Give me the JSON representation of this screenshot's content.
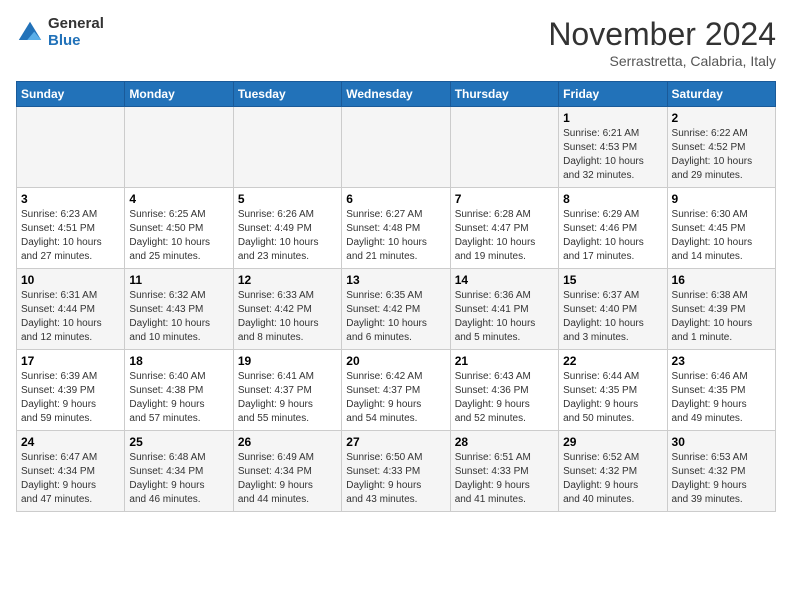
{
  "logo": {
    "general": "General",
    "blue": "Blue"
  },
  "title": "November 2024",
  "location": "Serrastretta, Calabria, Italy",
  "weekdays": [
    "Sunday",
    "Monday",
    "Tuesday",
    "Wednesday",
    "Thursday",
    "Friday",
    "Saturday"
  ],
  "weeks": [
    [
      {
        "day": "",
        "info": ""
      },
      {
        "day": "",
        "info": ""
      },
      {
        "day": "",
        "info": ""
      },
      {
        "day": "",
        "info": ""
      },
      {
        "day": "",
        "info": ""
      },
      {
        "day": "1",
        "info": "Sunrise: 6:21 AM\nSunset: 4:53 PM\nDaylight: 10 hours\nand 32 minutes."
      },
      {
        "day": "2",
        "info": "Sunrise: 6:22 AM\nSunset: 4:52 PM\nDaylight: 10 hours\nand 29 minutes."
      }
    ],
    [
      {
        "day": "3",
        "info": "Sunrise: 6:23 AM\nSunset: 4:51 PM\nDaylight: 10 hours\nand 27 minutes."
      },
      {
        "day": "4",
        "info": "Sunrise: 6:25 AM\nSunset: 4:50 PM\nDaylight: 10 hours\nand 25 minutes."
      },
      {
        "day": "5",
        "info": "Sunrise: 6:26 AM\nSunset: 4:49 PM\nDaylight: 10 hours\nand 23 minutes."
      },
      {
        "day": "6",
        "info": "Sunrise: 6:27 AM\nSunset: 4:48 PM\nDaylight: 10 hours\nand 21 minutes."
      },
      {
        "day": "7",
        "info": "Sunrise: 6:28 AM\nSunset: 4:47 PM\nDaylight: 10 hours\nand 19 minutes."
      },
      {
        "day": "8",
        "info": "Sunrise: 6:29 AM\nSunset: 4:46 PM\nDaylight: 10 hours\nand 17 minutes."
      },
      {
        "day": "9",
        "info": "Sunrise: 6:30 AM\nSunset: 4:45 PM\nDaylight: 10 hours\nand 14 minutes."
      }
    ],
    [
      {
        "day": "10",
        "info": "Sunrise: 6:31 AM\nSunset: 4:44 PM\nDaylight: 10 hours\nand 12 minutes."
      },
      {
        "day": "11",
        "info": "Sunrise: 6:32 AM\nSunset: 4:43 PM\nDaylight: 10 hours\nand 10 minutes."
      },
      {
        "day": "12",
        "info": "Sunrise: 6:33 AM\nSunset: 4:42 PM\nDaylight: 10 hours\nand 8 minutes."
      },
      {
        "day": "13",
        "info": "Sunrise: 6:35 AM\nSunset: 4:42 PM\nDaylight: 10 hours\nand 6 minutes."
      },
      {
        "day": "14",
        "info": "Sunrise: 6:36 AM\nSunset: 4:41 PM\nDaylight: 10 hours\nand 5 minutes."
      },
      {
        "day": "15",
        "info": "Sunrise: 6:37 AM\nSunset: 4:40 PM\nDaylight: 10 hours\nand 3 minutes."
      },
      {
        "day": "16",
        "info": "Sunrise: 6:38 AM\nSunset: 4:39 PM\nDaylight: 10 hours\nand 1 minute."
      }
    ],
    [
      {
        "day": "17",
        "info": "Sunrise: 6:39 AM\nSunset: 4:39 PM\nDaylight: 9 hours\nand 59 minutes."
      },
      {
        "day": "18",
        "info": "Sunrise: 6:40 AM\nSunset: 4:38 PM\nDaylight: 9 hours\nand 57 minutes."
      },
      {
        "day": "19",
        "info": "Sunrise: 6:41 AM\nSunset: 4:37 PM\nDaylight: 9 hours\nand 55 minutes."
      },
      {
        "day": "20",
        "info": "Sunrise: 6:42 AM\nSunset: 4:37 PM\nDaylight: 9 hours\nand 54 minutes."
      },
      {
        "day": "21",
        "info": "Sunrise: 6:43 AM\nSunset: 4:36 PM\nDaylight: 9 hours\nand 52 minutes."
      },
      {
        "day": "22",
        "info": "Sunrise: 6:44 AM\nSunset: 4:35 PM\nDaylight: 9 hours\nand 50 minutes."
      },
      {
        "day": "23",
        "info": "Sunrise: 6:46 AM\nSunset: 4:35 PM\nDaylight: 9 hours\nand 49 minutes."
      }
    ],
    [
      {
        "day": "24",
        "info": "Sunrise: 6:47 AM\nSunset: 4:34 PM\nDaylight: 9 hours\nand 47 minutes."
      },
      {
        "day": "25",
        "info": "Sunrise: 6:48 AM\nSunset: 4:34 PM\nDaylight: 9 hours\nand 46 minutes."
      },
      {
        "day": "26",
        "info": "Sunrise: 6:49 AM\nSunset: 4:34 PM\nDaylight: 9 hours\nand 44 minutes."
      },
      {
        "day": "27",
        "info": "Sunrise: 6:50 AM\nSunset: 4:33 PM\nDaylight: 9 hours\nand 43 minutes."
      },
      {
        "day": "28",
        "info": "Sunrise: 6:51 AM\nSunset: 4:33 PM\nDaylight: 9 hours\nand 41 minutes."
      },
      {
        "day": "29",
        "info": "Sunrise: 6:52 AM\nSunset: 4:32 PM\nDaylight: 9 hours\nand 40 minutes."
      },
      {
        "day": "30",
        "info": "Sunrise: 6:53 AM\nSunset: 4:32 PM\nDaylight: 9 hours\nand 39 minutes."
      }
    ]
  ]
}
